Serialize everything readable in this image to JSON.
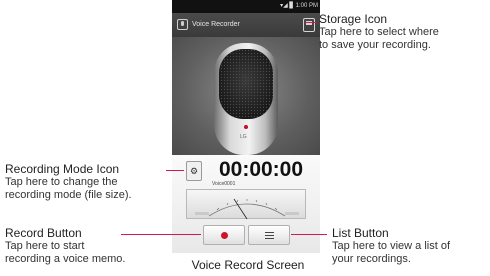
{
  "status_bar": {
    "time": "1:00 PM",
    "icons": "▾◢ ▊"
  },
  "app": {
    "title": "Voice Recorder",
    "timer": "00:00:00",
    "filename": "Voice0001",
    "brand": "LG"
  },
  "callouts": {
    "storage": {
      "title": "Storage Icon",
      "lines": [
        "Tap here to select where",
        "to save your recording."
      ]
    },
    "mode": {
      "title": "Recording Mode Icon",
      "lines": [
        "Tap here to change the",
        "recording mode (file size)."
      ]
    },
    "record": {
      "title": "Record Button",
      "lines": [
        "Tap here to start",
        "recording a voice memo."
      ]
    },
    "list": {
      "title": "List Button",
      "lines": [
        "Tap here to view a list of",
        "your recordings."
      ]
    }
  },
  "caption": "Voice Record Screen",
  "colors": {
    "accent": "#d1175c",
    "record_dot": "#d0112b"
  },
  "icons": {
    "storage": "storage-icon",
    "mode": "recording-mode-icon",
    "record": "record-dot-icon",
    "list": "list-icon"
  }
}
